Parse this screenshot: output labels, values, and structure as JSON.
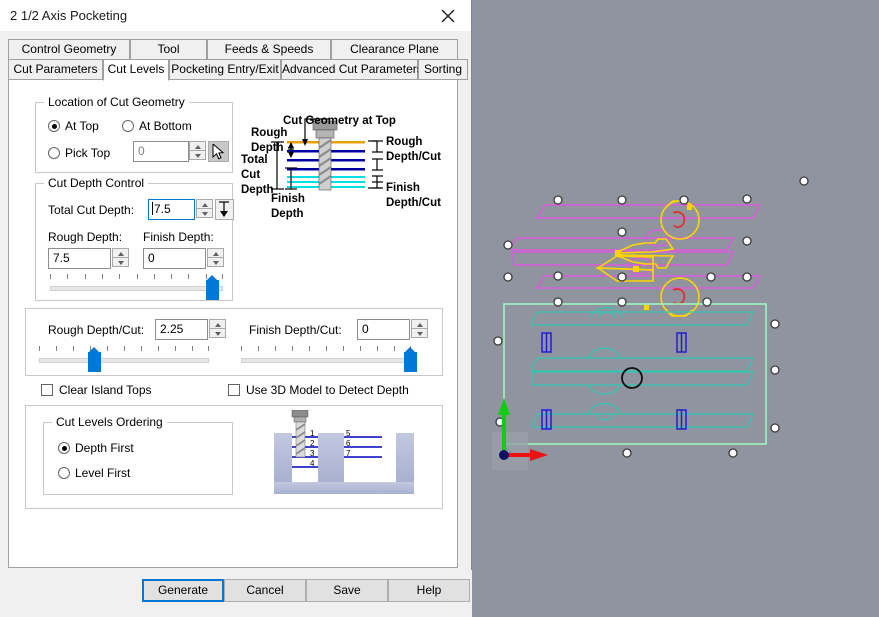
{
  "window": {
    "title": "2 1/2 Axis Pocketing",
    "close_icon": "close-icon"
  },
  "tabs": {
    "row_top": [
      {
        "label": "Control Geometry",
        "active": false
      },
      {
        "label": "Tool",
        "active": false
      },
      {
        "label": "Feeds & Speeds",
        "active": false
      },
      {
        "label": "Clearance Plane",
        "active": false
      }
    ],
    "row_bottom": [
      {
        "label": "Cut Parameters",
        "active": false
      },
      {
        "label": "Cut Levels",
        "active": true
      },
      {
        "label": "Pocketing Entry/Exit",
        "active": false
      },
      {
        "label": "Advanced Cut Parameters",
        "active": false
      },
      {
        "label": "Sorting",
        "active": false
      }
    ]
  },
  "location_group": {
    "legend": "Location of Cut Geometry",
    "at_top": {
      "label": "At Top",
      "selected": true
    },
    "at_bottom": {
      "label": "At Bottom",
      "selected": false
    },
    "pick_top": {
      "label": "Pick Top",
      "selected": false
    },
    "pick_value": "0",
    "pick_button_icon": "cursor-pick-icon"
  },
  "cut_depth_group": {
    "legend": "Cut Depth Control",
    "total_cut_depth": {
      "label": "Total Cut Depth:",
      "value": "7.5"
    },
    "total_depth_button_icon": "measure-depth-icon",
    "rough_depth": {
      "label": "Rough Depth:",
      "value": "7.5"
    },
    "finish_depth": {
      "label": "Finish Depth:",
      "value": "0"
    },
    "depth_slider": {
      "percent": 93,
      "ticks": 11
    }
  },
  "per_cut_group": {
    "rough_depth_cut": {
      "label": "Rough Depth/Cut:",
      "value": "2.25"
    },
    "finish_depth_cut": {
      "label": "Finish Depth/Cut:",
      "value": "0"
    },
    "rough_slider": {
      "percent": 31,
      "ticks": 11
    },
    "finish_slider": {
      "percent": 98,
      "ticks": 11
    }
  },
  "checkboxes": {
    "clear_island_tops": {
      "label": "Clear Island Tops",
      "checked": false
    },
    "use_3d_model": {
      "label": "Use 3D Model to Detect Depth",
      "checked": false
    }
  },
  "ordering_group": {
    "legend": "Cut Levels Ordering",
    "depth_first": {
      "label": "Depth First",
      "selected": true
    },
    "level_first": {
      "label": "Level First",
      "selected": false
    },
    "illustration_numbers": [
      "1",
      "2",
      "3",
      "4",
      "5",
      "6",
      "7"
    ]
  },
  "diagram": {
    "cut_geometry_at_top": "Cut Geometry at Top",
    "rough_depth_l1": "Rough",
    "rough_depth_l2": "Depth",
    "total_l1": "Total",
    "total_l2": "Cut",
    "total_l3": "Depth",
    "finish_depth_l1": "Finish",
    "finish_depth_l2": "Depth",
    "rough_per_cut_l1": "Rough",
    "rough_per_cut_l2": "Depth/Cut",
    "finish_per_cut_l1": "Finish",
    "finish_per_cut_l2": "Depth/Cut"
  },
  "buttons": {
    "generate": "Generate",
    "cancel": "Cancel",
    "save": "Save",
    "help": "Help"
  },
  "colors": {
    "accent": "#0078d7",
    "viewport_bg": "#8f949e",
    "magenta_geometry": "#e94fe9",
    "yellow_toolpath": "#ffd400",
    "red_arc": "#e03030",
    "teal_geometry": "#32c8b4",
    "green_boundary": "#9ff5c0",
    "blue_slot": "#2020d0",
    "axis_x": "#ee1111",
    "axis_y": "#11cc11"
  },
  "viewport": {
    "name": "cad-3d-viewport",
    "axis_x_label": "x-axis-arrow",
    "axis_y_label": "y-axis-arrow",
    "origin": "origin-marker"
  }
}
